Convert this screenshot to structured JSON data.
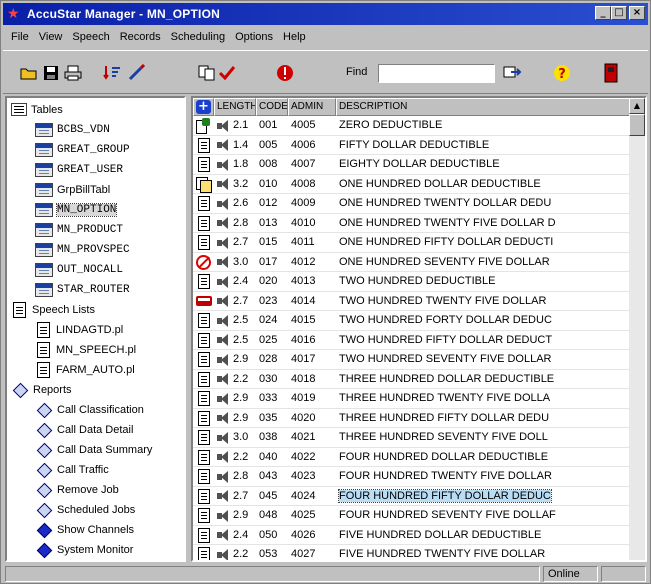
{
  "window": {
    "title": "AccuStar Manager - MN_OPTION",
    "minimize": "_",
    "maximize": "□",
    "close": "×"
  },
  "menu": [
    {
      "label": "File"
    },
    {
      "label": "View"
    },
    {
      "label": "Speech"
    },
    {
      "label": "Records"
    },
    {
      "label": "Scheduling"
    },
    {
      "label": "Options"
    },
    {
      "label": "Help"
    }
  ],
  "toolbar": {
    "find_label": "Find",
    "find_value": ""
  },
  "tree": {
    "tables_label": "Tables",
    "tables": [
      "BCBS_VDN",
      "GREAT_GROUP",
      "GREAT_USER",
      "GrpBillTabl",
      "MN_OPTION",
      "MN_PRODUCT",
      "MN_PROVSPEC",
      "OUT_NOCALL",
      "STAR_ROUTER"
    ],
    "speech_label": "Speech Lists",
    "speech": [
      "LINDAGTD.pl",
      "MN_SPEECH.pl",
      "FARM_AUTO.pl"
    ],
    "reports_label": "Reports",
    "reports": [
      "Call Classification",
      "Call Data Detail",
      "Call Data Summary",
      "Call Traffic",
      "Remove Job",
      "Scheduled Jobs",
      "Show Channels",
      "System Monitor"
    ]
  },
  "grid": {
    "headers": {
      "length": "LENGTH",
      "code": "CODE",
      "admin": "ADMIN",
      "description": "DESCRIPTION"
    },
    "rows": [
      {
        "icon": "mix",
        "length": "2.1",
        "code": "001",
        "admin": "4005",
        "description": "ZERO DEDUCTIBLE"
      },
      {
        "icon": "doc",
        "length": "1.4",
        "code": "005",
        "admin": "4006",
        "description": "FIFTY DOLLAR DEDUCTIBLE"
      },
      {
        "icon": "doc",
        "length": "1.8",
        "code": "008",
        "admin": "4007",
        "description": "EIGHTY DOLLAR DEDUCTIBLE"
      },
      {
        "icon": "multi",
        "length": "3.2",
        "code": "010",
        "admin": "4008",
        "description": "ONE HUNDRED DOLLAR DEDUCTIBLE"
      },
      {
        "icon": "doc",
        "length": "2.6",
        "code": "012",
        "admin": "4009",
        "description": "ONE HUNDRED TWENTY DOLLAR DEDU"
      },
      {
        "icon": "doc",
        "length": "2.8",
        "code": "013",
        "admin": "4010",
        "description": "ONE HUNDRED TWENTY FIVE DOLLAR D"
      },
      {
        "icon": "doc",
        "length": "2.7",
        "code": "015",
        "admin": "4011",
        "description": "ONE HUNDRED FIFTY DOLLAR DEDUCTI"
      },
      {
        "icon": "no",
        "length": "3.0",
        "code": "017",
        "admin": "4012",
        "description": "ONE HUNDRED SEVENTY FIVE DOLLAR"
      },
      {
        "icon": "doc",
        "length": "2.4",
        "code": "020",
        "admin": "4013",
        "description": "TWO HUNDRED DEDUCTIBLE"
      },
      {
        "icon": "bus",
        "length": "2.7",
        "code": "023",
        "admin": "4014",
        "description": "TWO HUNDRED TWENTY FIVE DOLLAR"
      },
      {
        "icon": "doc",
        "length": "2.5",
        "code": "024",
        "admin": "4015",
        "description": "TWO HUNDRED FORTY DOLLAR DEDUC"
      },
      {
        "icon": "doc",
        "length": "2.5",
        "code": "025",
        "admin": "4016",
        "description": "TWO HUNDRED FIFTY DOLLAR DEDUCT"
      },
      {
        "icon": "doc",
        "length": "2.9",
        "code": "028",
        "admin": "4017",
        "description": "TWO HUNDRED SEVENTY FIVE DOLLAR"
      },
      {
        "icon": "doc",
        "length": "2.2",
        "code": "030",
        "admin": "4018",
        "description": "THREE HUNDRED DOLLAR DEDUCTIBLE"
      },
      {
        "icon": "doc",
        "length": "2.9",
        "code": "033",
        "admin": "4019",
        "description": "THREE HUNDRED TWENTY FIVE DOLLA"
      },
      {
        "icon": "doc",
        "length": "2.9",
        "code": "035",
        "admin": "4020",
        "description": "THREE HUNDRED FIFTY DOLLAR DEDU"
      },
      {
        "icon": "doc",
        "length": "3.0",
        "code": "038",
        "admin": "4021",
        "description": "THREE HUNDRED SEVENTY FIVE DOLL"
      },
      {
        "icon": "doc",
        "length": "2.2",
        "code": "040",
        "admin": "4022",
        "description": "FOUR HUNDRED DOLLAR DEDUCTIBLE"
      },
      {
        "icon": "doc",
        "length": "2.8",
        "code": "043",
        "admin": "4023",
        "description": "FOUR HUNDRED TWENTY FIVE DOLLAR"
      },
      {
        "icon": "doc",
        "length": "2.7",
        "code": "045",
        "admin": "4024",
        "description": "FOUR HUNDRED FIFTY DOLLAR DEDUC",
        "selected": true
      },
      {
        "icon": "doc",
        "length": "2.9",
        "code": "048",
        "admin": "4025",
        "description": "FOUR HUNDRED SEVENTY FIVE DOLLAF"
      },
      {
        "icon": "doc",
        "length": "2.4",
        "code": "050",
        "admin": "4026",
        "description": "FIVE HUNDRED DOLLAR DEDUCTIBLE"
      },
      {
        "icon": "doc",
        "length": "2.2",
        "code": "053",
        "admin": "4027",
        "description": "FIVE HUNDRED TWENTY FIVE DOLLAR"
      }
    ]
  },
  "status": {
    "state": "Online"
  },
  "colors": {
    "titlebar": "#0a1fa8",
    "selection": "#b8ddf5",
    "error": "#e00000"
  }
}
